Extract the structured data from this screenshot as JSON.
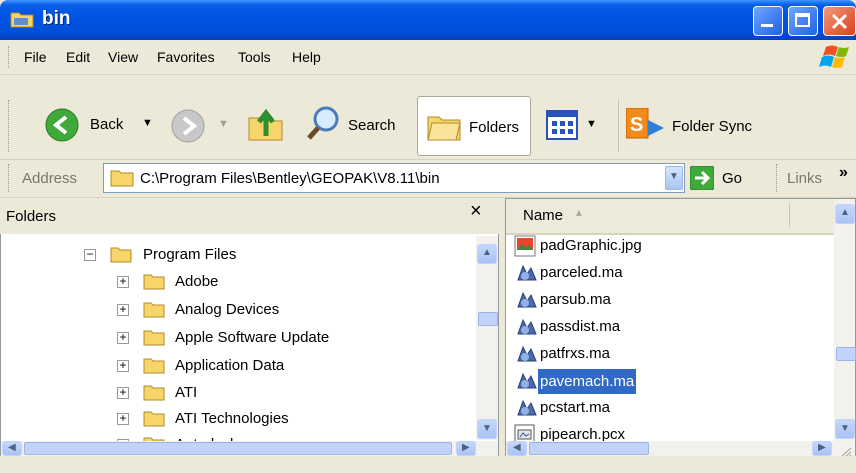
{
  "window": {
    "title": "bin"
  },
  "menu": {
    "items": [
      "File",
      "Edit",
      "View",
      "Favorites",
      "Tools",
      "Help"
    ]
  },
  "toolbar": {
    "back_label": "Back",
    "search_label": "Search",
    "folders_label": "Folders",
    "folder_sync_label": "Folder Sync"
  },
  "address": {
    "label": "Address",
    "value": "C:\\Program Files\\Bentley\\GEOPAK\\V8.11\\bin",
    "go_label": "Go",
    "links_label": "Links",
    "more_glyph": "»"
  },
  "folders_pane": {
    "title": "Folders",
    "close_glyph": "×",
    "items": [
      {
        "label": "Program Files",
        "expander": "−"
      },
      {
        "label": "Adobe",
        "expander": "+"
      },
      {
        "label": "Analog Devices",
        "expander": "+"
      },
      {
        "label": "Apple Software Update",
        "expander": "+"
      },
      {
        "label": "Application Data",
        "expander": "+"
      },
      {
        "label": "ATI",
        "expander": "+"
      },
      {
        "label": "ATI Technologies",
        "expander": "+"
      },
      {
        "label": "Autodesk",
        "expander": "+"
      }
    ]
  },
  "file_pane": {
    "column_name": "Name",
    "files": [
      {
        "name": "padGraphic.jpg",
        "icon": "image-file-icon"
      },
      {
        "name": "parceled.ma",
        "icon": "ma-file-icon"
      },
      {
        "name": "parsub.ma",
        "icon": "ma-file-icon"
      },
      {
        "name": "passdist.ma",
        "icon": "ma-file-icon"
      },
      {
        "name": "patfrxs.ma",
        "icon": "ma-file-icon"
      },
      {
        "name": "pavemach.ma",
        "icon": "ma-file-icon",
        "selected": true
      },
      {
        "name": "pcstart.ma",
        "icon": "ma-file-icon"
      },
      {
        "name": "pipearch.pcx",
        "icon": "pcx-file-icon"
      }
    ]
  },
  "colors": {
    "titlebar": "#0054e3",
    "selection": "#316ac5",
    "folder": "#f7d56b",
    "close_button": "#d8411c"
  }
}
